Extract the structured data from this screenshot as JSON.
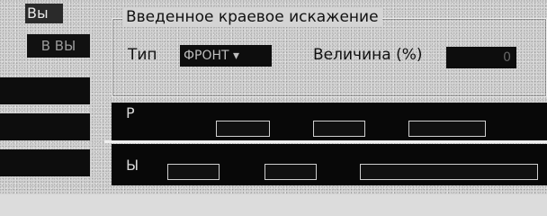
{
  "left_panel": {
    "top_label": "Вы",
    "top_button": "В ВЫ"
  },
  "group": {
    "title": "Введенное краевое искажение",
    "type_label": "Тип",
    "type_value": "ФРОНТ",
    "type_arrow": "▾",
    "magnitude_label": "Величина (%)",
    "magnitude_value": "0"
  },
  "signals": {
    "top_label": "Р",
    "bottom_label": "Ы"
  }
}
